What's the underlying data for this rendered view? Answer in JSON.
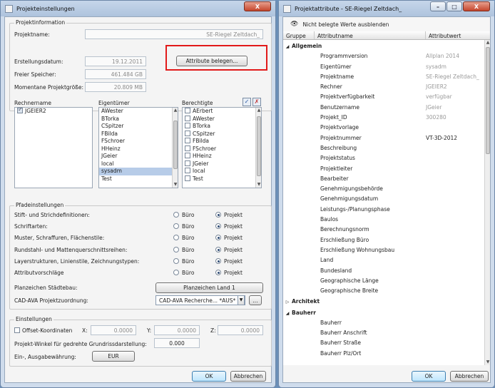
{
  "left": {
    "title": "Projekteinstellungen",
    "close_glyph": "X",
    "projektinfo": {
      "group_label": "Projektinformation",
      "name_label": "Projektname:",
      "name_value": "SE-Riegel Zeltdach_",
      "erstellung_label": "Erstellungsdatum:",
      "erstellung_value": "19.12.2011",
      "speicher_label": "Freier Speicher:",
      "speicher_value": "461.484 GB",
      "groesse_label": "Momentane Projektgröße:",
      "groesse_value": "20.809 MB",
      "attribute_button": "Attribute belegen..."
    },
    "rechnername": {
      "label": "Rechnername",
      "items": [
        {
          "name": "JGEIER2",
          "checked": true
        }
      ]
    },
    "eigentuemer": {
      "label": "Eigentümer",
      "items": [
        "AWester",
        "BTorka",
        "CSpitzer",
        "FBilda",
        "FSchroer",
        "HHeinz",
        "JGeier",
        "local",
        "sysadm",
        "Test"
      ],
      "selected": "sysadm"
    },
    "berechtigte": {
      "label": "Berechtigte",
      "items": [
        "AErbert",
        "AWester",
        "BTorka",
        "CSpitzer",
        "FBilda",
        "FSchroer",
        "HHeinz",
        "JGeier",
        "local",
        "Test"
      ]
    },
    "pfade": {
      "group_label": "Pfadeinstellungen",
      "opt1": "Büro",
      "opt2": "Projekt",
      "rows": [
        {
          "label": "Stift- und Strichdefinitionen:",
          "value": "Projekt"
        },
        {
          "label": "Schriftarten:",
          "value": "Projekt"
        },
        {
          "label": "Muster, Schraffuren, Flächenstile:",
          "value": "Projekt"
        },
        {
          "label": "Rundstahl- und Mattenquerschnittsreihen:",
          "value": "Projekt"
        },
        {
          "label": "Layerstrukturen, Linienstile, Zeichnungstypen:",
          "value": "Projekt"
        },
        {
          "label": "Attributvorschläge",
          "value": "Projekt"
        }
      ],
      "planzeichen_label": "Planzeichen Städtebau:",
      "planzeichen_button": "Planzeichen Land 1",
      "cad_label": "CAD-AVA Projektzuordnung:",
      "cad_value": "CAD-AVA Recherche... *AUS*",
      "cad_more": "..."
    },
    "einstellungen": {
      "group_label": "Einstellungen",
      "offset_label": "Offset-Koordinaten",
      "x_label": "X:",
      "x_value": "0.0000",
      "y_label": "Y:",
      "y_value": "0.0000",
      "z_label": "Z:",
      "z_value": "0.0000",
      "winkel_label": "Projekt-Winkel für gedrehte Grundrissdarstellung:",
      "winkel_value": "0.000",
      "waehrung_label": "Ein-, Ausgabewährung:",
      "waehrung_value": "EUR"
    },
    "ok": "OK",
    "cancel": "Abbrechen"
  },
  "right": {
    "title": "Projektattribute - SE-Riegel Zeltdach_",
    "toggle_label": "Nicht belegte Werte ausblenden",
    "columns": [
      "Gruppe",
      "Attributname",
      "Attributwert"
    ],
    "categories": [
      {
        "name": "Allgemein",
        "expanded": true,
        "rows": [
          {
            "name": "Programmversion",
            "value": "Allplan 2014"
          },
          {
            "name": "Eigentümer",
            "value": "sysadm"
          },
          {
            "name": "Projektname",
            "value": "SE-Riegel Zeltdach_"
          },
          {
            "name": "Rechner",
            "value": "JGEIER2"
          },
          {
            "name": "Projektverfügbarkeit",
            "value": "verfügbar"
          },
          {
            "name": "Benutzername",
            "value": "JGeier"
          },
          {
            "name": "Projekt_ID",
            "value": "300280"
          },
          {
            "name": "Projektvorlage",
            "value": ""
          },
          {
            "name": "Projektnummer",
            "value": "VT-3D-2012",
            "editable": true
          },
          {
            "name": "Beschreibung",
            "value": ""
          },
          {
            "name": "Projektstatus",
            "value": ""
          },
          {
            "name": "Projektleiter",
            "value": ""
          },
          {
            "name": "Bearbeiter",
            "value": ""
          },
          {
            "name": "Genehmigungsbehörde",
            "value": ""
          },
          {
            "name": "Genehmigungsdatum",
            "value": ""
          },
          {
            "name": "Leistungs-/Planungsphase",
            "value": ""
          },
          {
            "name": "Baulos",
            "value": ""
          },
          {
            "name": "Berechnungsnorm",
            "value": ""
          },
          {
            "name": "Erschließung Büro",
            "value": ""
          },
          {
            "name": "Erschließung Wohnungsbau",
            "value": ""
          },
          {
            "name": "Land",
            "value": ""
          },
          {
            "name": "Bundesland",
            "value": ""
          },
          {
            "name": "Geographische Länge",
            "value": ""
          },
          {
            "name": "Geographische Breite",
            "value": ""
          }
        ]
      },
      {
        "name": "Architekt",
        "expanded": false,
        "rows": []
      },
      {
        "name": "Bauherr",
        "expanded": true,
        "rows": [
          {
            "name": "Bauherr",
            "value": ""
          },
          {
            "name": "Bauherr Anschrift",
            "value": ""
          },
          {
            "name": "Bauherr Straße",
            "value": ""
          },
          {
            "name": "Bauherr Plz/Ort",
            "value": ""
          }
        ]
      }
    ],
    "ok": "OK",
    "cancel": "Abbrechen"
  }
}
